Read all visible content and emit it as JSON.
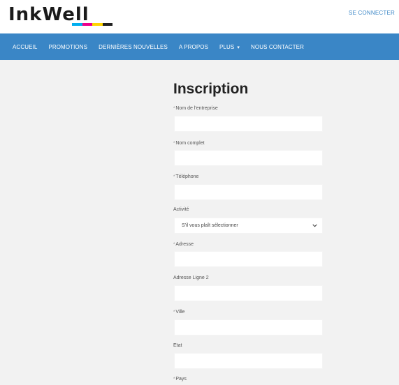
{
  "brand": {
    "name": "InkWell",
    "logo_colors": [
      "#00aeef",
      "#ec008c",
      "#ffd400",
      "#222222"
    ]
  },
  "header": {
    "login_label": "SE CONNECTER"
  },
  "nav": {
    "items": [
      {
        "label": "ACCUEIL"
      },
      {
        "label": "PROMOTIONS"
      },
      {
        "label": "DERNIÈRES NOUVELLES"
      },
      {
        "label": "A PROPOS"
      },
      {
        "label": "PLUS"
      },
      {
        "label": "NOUS CONTACTER"
      }
    ]
  },
  "form": {
    "title": "Inscription",
    "required_marker": "*",
    "fields": [
      {
        "label": "Nom de l'entreprise",
        "required": true,
        "value": ""
      },
      {
        "label": "Nom complet",
        "required": true,
        "value": ""
      },
      {
        "label": "Téléphone",
        "required": true,
        "value": ""
      },
      {
        "label": "Activité",
        "required": false,
        "type": "select",
        "value": "S'il vous plaît sélectionner"
      },
      {
        "label": "Adresse",
        "required": true,
        "value": ""
      },
      {
        "label": "Adresse Ligne 2",
        "required": false,
        "value": ""
      },
      {
        "label": "Ville",
        "required": true,
        "value": ""
      },
      {
        "label": "Etat",
        "required": false,
        "value": ""
      },
      {
        "label": "Pays",
        "required": true,
        "value": ""
      }
    ]
  },
  "colors": {
    "primary": "#3a86c6",
    "page_background": "#f2f2f2"
  }
}
